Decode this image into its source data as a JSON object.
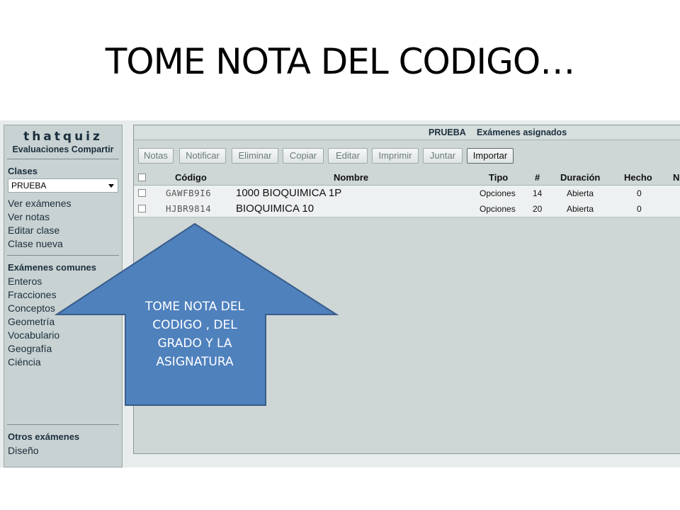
{
  "slide": {
    "title": "TOME NOTA DEL CODIGO…",
    "callout_text": "TOME NOTA DEL CODIGO , DEL GRADO Y LA ASIGNATURA"
  },
  "sidebar": {
    "brand": "thatquiz",
    "brand_sub": "Evaluaciones Compartir",
    "clases_title": "Clases",
    "class_select_value": "PRUEBA",
    "class_links": [
      "Ver exámenes",
      "Ver notas",
      "Editar clase",
      "Clase nueva"
    ],
    "comunes_title": "Exámenes comunes",
    "comunes_links": [
      "Enteros",
      "Fracciones",
      "Conceptos",
      "Geometría",
      "Vocabulario",
      "Geografía",
      "Ciéncia"
    ],
    "otros_title": "Otros exámenes",
    "otros_links": [
      "Diseño"
    ]
  },
  "main": {
    "class_name": "PRUEBA",
    "header_title": "Exámenes asignados",
    "toolbar": [
      "Notas",
      "Notificar",
      "Eliminar",
      "Copiar",
      "Editar",
      "Imprimir",
      "Juntar",
      "Importar"
    ],
    "columns": [
      "Código",
      "Nombre",
      "Tipo",
      "#",
      "Duración",
      "Hecho",
      "N"
    ],
    "rows": [
      {
        "code": "GAWFB9I6",
        "name": "1000 BIOQUIMICA 1P",
        "type": "Opciones",
        "count": "14",
        "duration": "Abierta",
        "done": "0"
      },
      {
        "code": "HJBR9814",
        "name": "BIOQUIMICA 10",
        "type": "Opciones",
        "count": "20",
        "duration": "Abierta",
        "done": "0"
      }
    ]
  },
  "colors": {
    "arrow_fill": "#4f81bd",
    "arrow_stroke": "#385d8a"
  }
}
